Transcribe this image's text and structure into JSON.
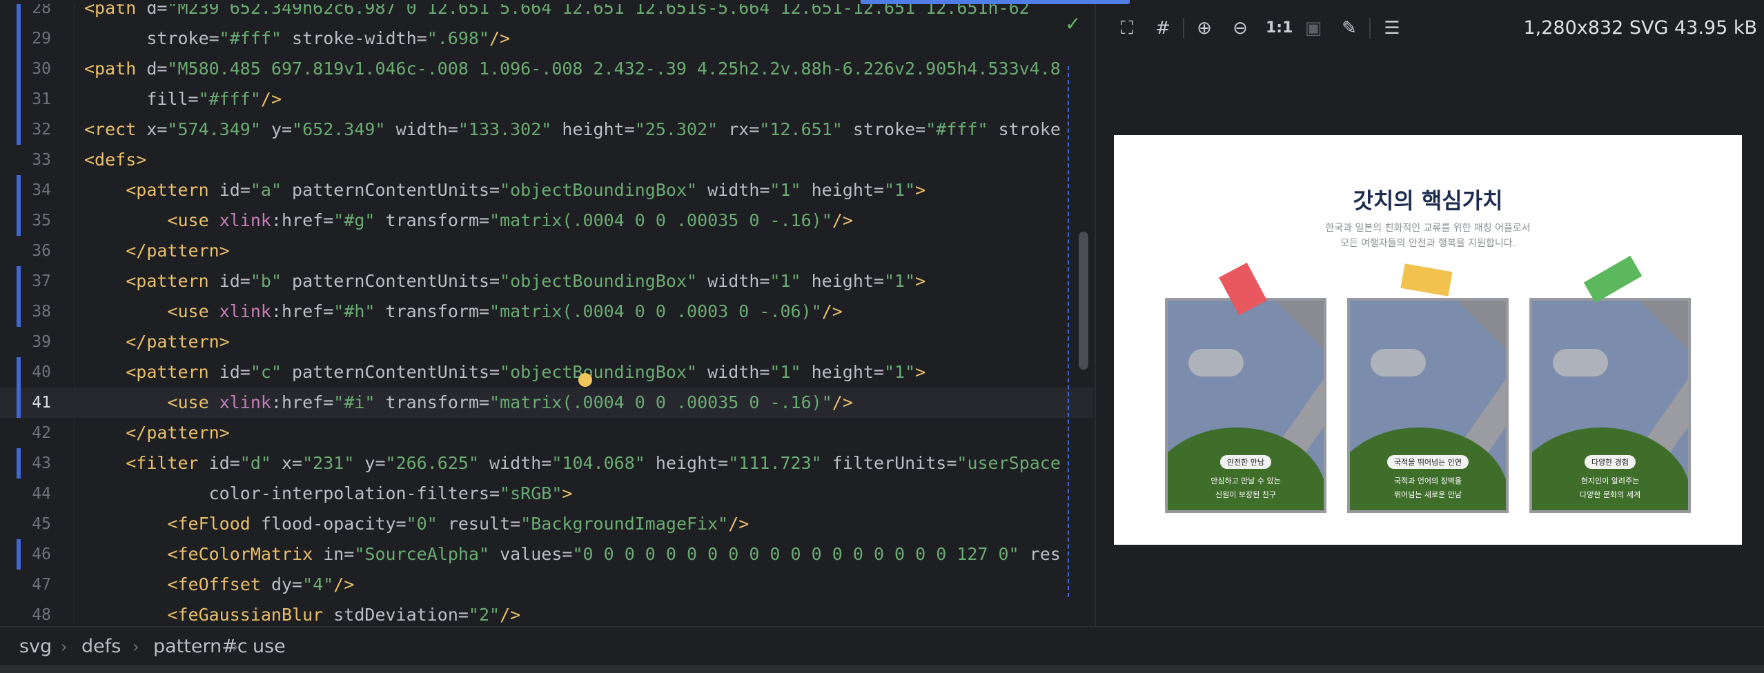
{
  "editor": {
    "lines": [
      {
        "num": "28",
        "vcs": true,
        "html": "<span class='t'>&lt;path </span><span class='a'>d=</span><span class='s'>\"M239 652.349h62c6.987 0 12.651 5.664 12.651 12.651s-5.664 12.651-12.651 12.651h-62</span>"
      },
      {
        "num": "29",
        "vcs": true,
        "html": "      <span class='a'>stroke=</span><span class='s'>\"#fff\"</span><span class='a'> stroke-width=</span><span class='s'>\".698\"</span><span class='t'>/&gt;</span>"
      },
      {
        "num": "30",
        "vcs": true,
        "html": "<span class='t'>&lt;path </span><span class='a'>d=</span><span class='s'>\"M580.485 697.819v1.046c-.008 1.096-.008 2.432-.39 4.25h2.2v.88h-6.226v2.905h4.533v4.8</span>"
      },
      {
        "num": "31",
        "vcs": true,
        "html": "      <span class='a'>fill=</span><span class='s'>\"#fff\"</span><span class='t'>/&gt;</span>"
      },
      {
        "num": "32",
        "vcs": true,
        "html": "<span class='t'>&lt;rect </span><span class='a'>x=</span><span class='s'>\"574.349\"</span><span class='a'> y=</span><span class='s'>\"652.349\"</span><span class='a'> width=</span><span class='s'>\"133.302\"</span><span class='a'> height=</span><span class='s'>\"25.302\"</span><span class='a'> rx=</span><span class='s'>\"12.651\"</span><span class='a'> stroke=</span><span class='s'>\"#fff\"</span><span class='a'> stroke</span>"
      },
      {
        "num": "33",
        "vcs": false,
        "html": "<span class='t'>&lt;defs&gt;</span>"
      },
      {
        "num": "34",
        "vcs": true,
        "html": "    <span class='t'>&lt;pattern </span><span class='a'>id=</span><span class='s'>\"a\"</span><span class='a'> patternContentUnits=</span><span class='s'>\"objectBoundingBox\"</span><span class='a'> width=</span><span class='s'>\"1\"</span><span class='a'> height=</span><span class='s'>\"1\"</span><span class='t'>&gt;</span>"
      },
      {
        "num": "35",
        "vcs": true,
        "html": "        <span class='t'>&lt;use </span><span class='p'>xlink</span><span class='a'>:href=</span><span class='s'>\"#g\"</span><span class='a'> transform=</span><span class='s'>\"matrix(.0004 0 0 .00035 0 -.16)\"</span><span class='t'>/&gt;</span>"
      },
      {
        "num": "36",
        "vcs": false,
        "html": "    <span class='t'>&lt;/pattern&gt;</span>"
      },
      {
        "num": "37",
        "vcs": true,
        "html": "    <span class='t'>&lt;pattern </span><span class='a'>id=</span><span class='s'>\"b\"</span><span class='a'> patternContentUnits=</span><span class='s'>\"objectBoundingBox\"</span><span class='a'> width=</span><span class='s'>\"1\"</span><span class='a'> height=</span><span class='s'>\"1\"</span><span class='t'>&gt;</span>"
      },
      {
        "num": "38",
        "vcs": true,
        "html": "        <span class='t'>&lt;use </span><span class='p'>xlink</span><span class='a'>:href=</span><span class='s'>\"#h\"</span><span class='a'> transform=</span><span class='s'>\"matrix(.0004 0 0 .0003 0 -.06)\"</span><span class='t'>/&gt;</span>"
      },
      {
        "num": "39",
        "vcs": false,
        "html": "    <span class='t'>&lt;/pattern&gt;</span>"
      },
      {
        "num": "40",
        "vcs": true,
        "html": "    <span class='t'>&lt;pattern </span><span class='a'>id=</span><span class='s'>\"c\"</span><span class='a'> patternContentUnits=</span><span class='s'>\"objectBoundingBox\"</span><span class='a'> width=</span><span class='s'>\"1\"</span><span class='a'> height=</span><span class='s'>\"1\"</span><span class='t'>&gt;</span>"
      },
      {
        "num": "41",
        "vcs": true,
        "current": true,
        "html": "        <span class='t'>&lt;use </span><span class='p'>xlink</span><span class='a'>:href=</span><span class='s'>\"#i\"</span><span class='a'> transform=</span><span class='s'>\"matrix(.0004 0 0 .00035 0 -.16)\"</span><span class='t'>/&gt;</span>"
      },
      {
        "num": "42",
        "vcs": false,
        "html": "    <span class='t'>&lt;/pattern&gt;</span>"
      },
      {
        "num": "43",
        "vcs": true,
        "html": "    <span class='t'>&lt;filter </span><span class='a'>id=</span><span class='s'>\"d\"</span><span class='a'> x=</span><span class='s'>\"231\"</span><span class='a'> y=</span><span class='s'>\"266.625\"</span><span class='a'> width=</span><span class='s'>\"104.068\"</span><span class='a'> height=</span><span class='s'>\"111.723\"</span><span class='a'> filterUnits=</span><span class='s'>\"userSpace</span>"
      },
      {
        "num": "44",
        "vcs": false,
        "html": "            <span class='a'>color-interpolation-filters=</span><span class='s'>\"sRGB\"</span><span class='t'>&gt;</span>"
      },
      {
        "num": "45",
        "vcs": false,
        "html": "        <span class='t'>&lt;feFlood </span><span class='a'>flood-opacity=</span><span class='s'>\"0\"</span><span class='a'> result=</span><span class='s'>\"BackgroundImageFix\"</span><span class='t'>/&gt;</span>"
      },
      {
        "num": "46",
        "vcs": true,
        "html": "        <span class='t'>&lt;feColorMatrix </span><span class='a'>in=</span><span class='s'>\"SourceAlpha\"</span><span class='a'> values=</span><span class='s'>\"0 0 0 0 0 0 0 0 0 0 0 0 0 0 0 0 0 0 127 0\"</span><span class='a'> res</span>"
      },
      {
        "num": "47",
        "vcs": false,
        "html": "        <span class='t'>&lt;feOffset </span><span class='a'>dy=</span><span class='s'>\"4\"</span><span class='t'>/&gt;</span>"
      },
      {
        "num": "48",
        "vcs": false,
        "html": "        <span class='t'>&lt;feGaussianBlur </span><span class='a'>stdDeviation=</span><span class='s'>\"2\"</span><span class='t'>/&gt;</span>"
      }
    ]
  },
  "toolbar": {
    "actual_size_label": "1:1",
    "icons": [
      "fit-screen-icon",
      "grid-icon",
      "zoom-in-icon",
      "zoom-out-icon",
      "actual-size",
      "background-icon",
      "color-picker-icon",
      "layout-icon"
    ]
  },
  "file_info": "1,280x832 SVG 43.95 kB",
  "preview": {
    "title": "갓치의 핵심가치",
    "subtitle_line1": "한국과 일본의 친화적인 교류를 위한 매칭 어플로서",
    "subtitle_line2": "모든 여행자들의 안전과 행복을 지원합니다.",
    "cards": [
      {
        "badge": "안전한 만남",
        "caption1": "안심하고 만날 수 있는",
        "caption2": "신원이 보장된 친구",
        "tag_color": "#e8585e"
      },
      {
        "badge": "국적을 뛰어넘는 인연",
        "caption1": "국적과 언어의 장벽을",
        "caption2": "뛰어넘는 새로운 만남",
        "tag_color": "#f2c14e"
      },
      {
        "badge": "다양한 경험",
        "caption1": "현지인이 알려주는",
        "caption2": "다양한 문화의 세계",
        "tag_color": "#5cb85c"
      }
    ]
  },
  "breadcrumb": [
    "svg",
    "defs",
    "pattern#c",
    "use"
  ],
  "colors": {
    "accent": "#4e7ee6",
    "editor_bg": "#1e1f22",
    "tag": "#e8bf6a",
    "string": "#6aab73"
  }
}
